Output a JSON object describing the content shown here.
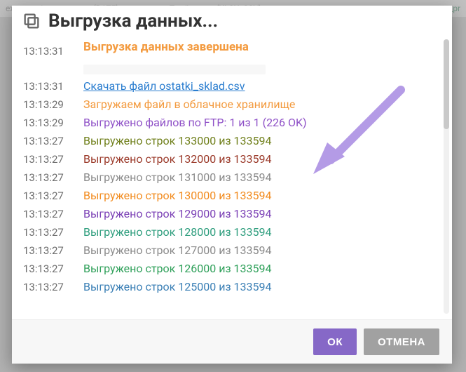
{
  "backdrop": {
    "left": "export_price_summary (DATE)",
    "mid": "Прайс-лист (XLSX, CSV)",
    "right": "export_pr"
  },
  "dialog": {
    "title": "Выгрузка данных..."
  },
  "log": [
    {
      "time": "13:13:31",
      "text": "Выгрузка данных завершена",
      "cls": "msg-title",
      "first": true
    },
    {
      "time": "",
      "text": "",
      "cls": "msg-sep"
    },
    {
      "time": "13:13:31",
      "text": "Скачать файл ostatki_sklad.csv",
      "cls": "color-link",
      "link": true
    },
    {
      "time": "13:13:29",
      "text": "Загружаем файл в облачное хранилище",
      "cls": "color-orange"
    },
    {
      "time": "13:13:29",
      "text": "Выгружено файлов по FTP: 1 из 1 (226 OK)",
      "cls": "color-purple"
    },
    {
      "time": "13:13:27",
      "text": "Выгружено строк 133000 из 133594",
      "cls": "color-olive"
    },
    {
      "time": "13:13:27",
      "text": "Выгружено строк 132000 из 133594",
      "cls": "color-brown"
    },
    {
      "time": "13:13:27",
      "text": "Выгружено строк 131000 из 133594",
      "cls": "color-gray"
    },
    {
      "time": "13:13:27",
      "text": "Выгружено строк 130000 из 133594",
      "cls": "color-orange2"
    },
    {
      "time": "13:13:27",
      "text": "Выгружено строк 129000 из 133594",
      "cls": "color-purple2"
    },
    {
      "time": "13:13:27",
      "text": "Выгружено строк 128000 из 133594",
      "cls": "color-teal"
    },
    {
      "time": "13:13:27",
      "text": "Выгружено строк 127000 из 133594",
      "cls": "color-gray2"
    },
    {
      "time": "13:13:27",
      "text": "Выгружено строк 126000 из 133594",
      "cls": "color-green"
    },
    {
      "time": "13:13:27",
      "text": "Выгружено строк 125000 из 133594",
      "cls": "color-blue"
    }
  ],
  "buttons": {
    "ok": "ОК",
    "cancel": "ОТМЕНА"
  }
}
